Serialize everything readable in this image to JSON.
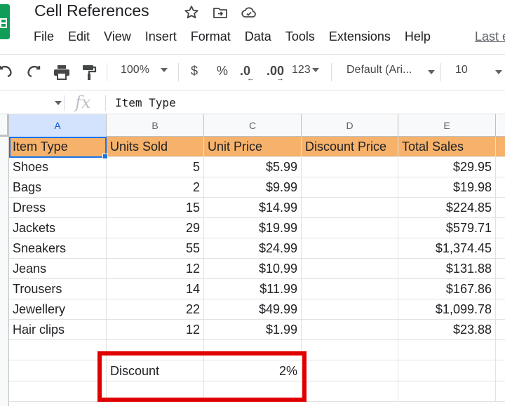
{
  "app": {
    "doc_title": "Cell References",
    "menu": [
      "File",
      "Edit",
      "View",
      "Insert",
      "Format",
      "Data",
      "Tools",
      "Extensions",
      "Help"
    ],
    "last_edit": "Last e"
  },
  "toolbar": {
    "zoom": "100%",
    "currency": "$",
    "percent": "%",
    "decrease_decimal": ".0",
    "increase_decimal": ".00",
    "number_format": "123",
    "font": "Default (Ari...",
    "font_size": "10"
  },
  "formula_bar": {
    "fx": "fx",
    "content": "Item Type"
  },
  "columns": [
    "A",
    "B",
    "C",
    "D",
    "E"
  ],
  "header_row": [
    "Item Type",
    "Units Sold",
    "Unit Price",
    "Discount Price",
    "Total Sales"
  ],
  "rows": [
    [
      "Shoes",
      "5",
      "$5.99",
      "",
      "$29.95"
    ],
    [
      "Bags",
      "2",
      "$9.99",
      "",
      "$19.98"
    ],
    [
      "Dress",
      "15",
      "$14.99",
      "",
      "$224.85"
    ],
    [
      "Jackets",
      "29",
      "$19.99",
      "",
      "$579.71"
    ],
    [
      "Sneakers",
      "55",
      "$24.99",
      "",
      "$1,374.45"
    ],
    [
      "Jeans",
      "12",
      "$10.99",
      "",
      "$131.88"
    ],
    [
      "Trousers",
      "14",
      "$11.99",
      "",
      "$167.86"
    ],
    [
      "Jewellery",
      "22",
      "$49.99",
      "",
      "$1,099.78"
    ],
    [
      "Hair clips",
      "12",
      "$1.99",
      "",
      "$23.88"
    ]
  ],
  "discount": {
    "label": "Discount",
    "value": "2%"
  },
  "colors": {
    "header_fill": "#f6b26b",
    "highlight_border": "#e00000",
    "selection": "#1a73e8",
    "sheets_green": "#0f9d58"
  }
}
